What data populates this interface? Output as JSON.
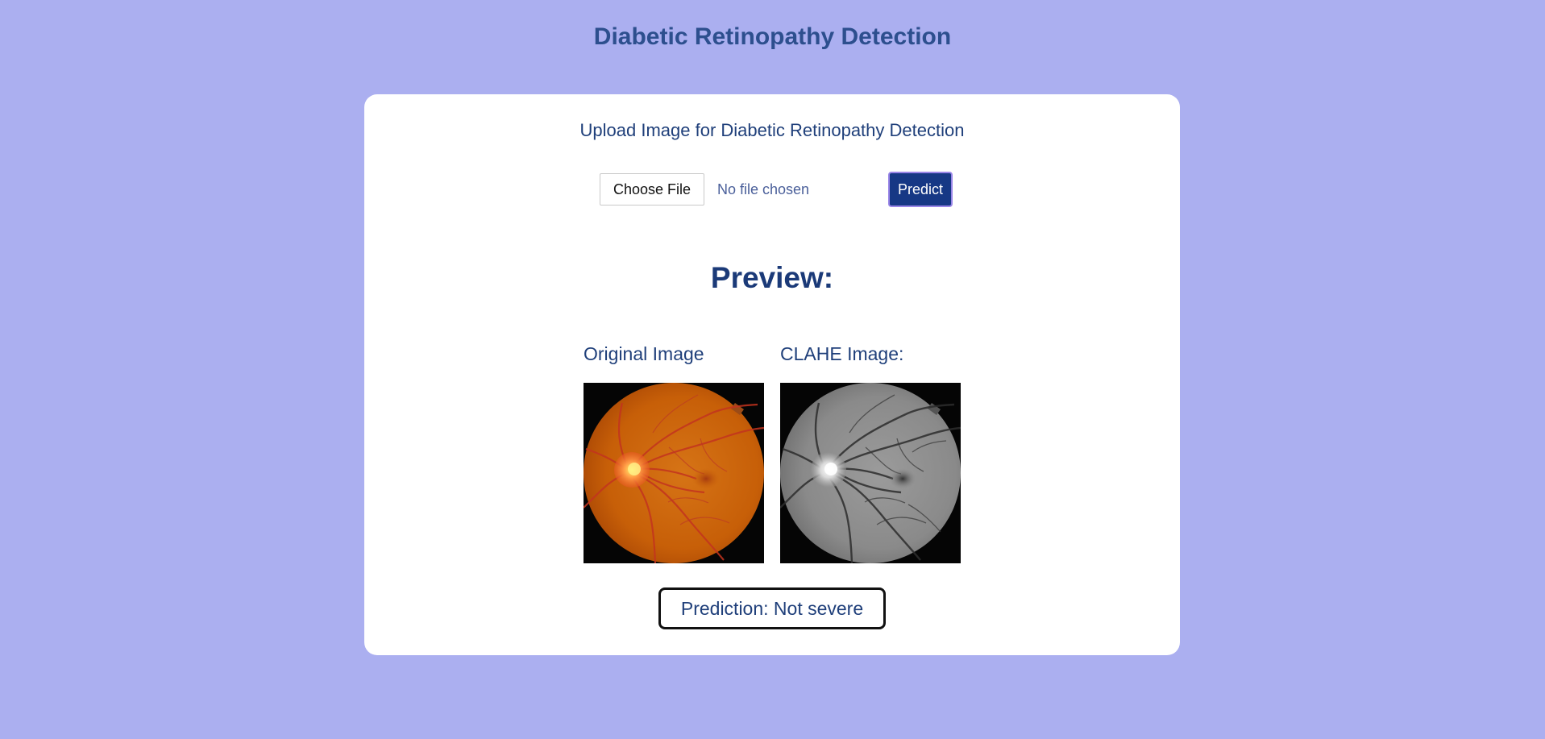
{
  "page": {
    "title": "Diabetic Retinopathy Detection"
  },
  "upload": {
    "heading": "Upload Image for Diabetic Retinopathy Detection",
    "choose_file_label": "Choose File",
    "file_status": "No file chosen",
    "predict_label": "Predict"
  },
  "preview": {
    "heading": "Preview:",
    "original_label": "Original Image",
    "clahe_label": "CLAHE Image:"
  },
  "result": {
    "prediction_text": "Prediction: Not severe"
  },
  "colors": {
    "background": "#abaff0",
    "card": "#ffffff",
    "title": "#2d4f8e",
    "text": "#1f3f7a",
    "predict_button": "#163885"
  }
}
